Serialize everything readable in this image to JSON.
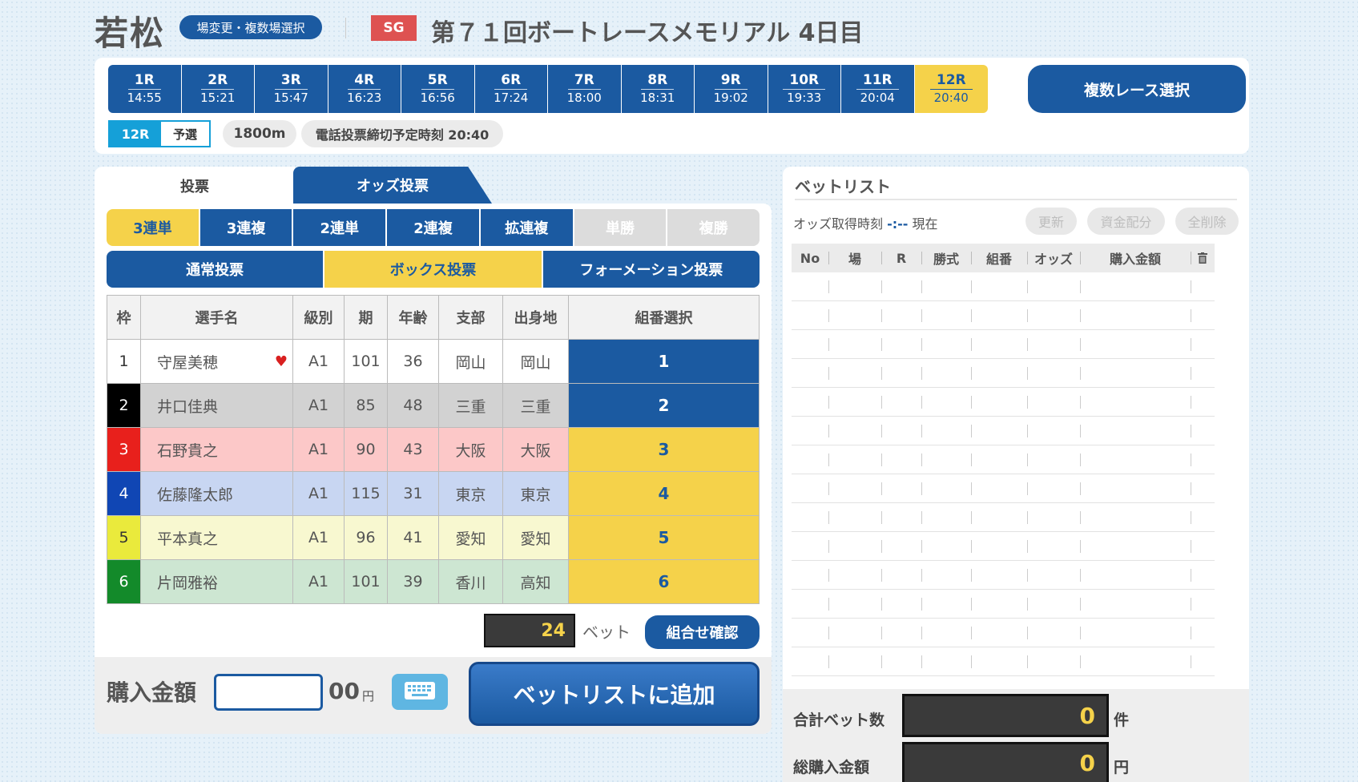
{
  "header": {
    "venue": "若松",
    "venue_change_label": "場変更・複数場選択",
    "grade": "SG",
    "race_title": "第７１回ボートレースメモリアル 4日目"
  },
  "races": [
    {
      "no": "1R",
      "time": "14:55"
    },
    {
      "no": "2R",
      "time": "15:21"
    },
    {
      "no": "3R",
      "time": "15:47"
    },
    {
      "no": "4R",
      "time": "16:23"
    },
    {
      "no": "5R",
      "time": "16:56"
    },
    {
      "no": "6R",
      "time": "17:24"
    },
    {
      "no": "7R",
      "time": "18:00"
    },
    {
      "no": "8R",
      "time": "18:31"
    },
    {
      "no": "9R",
      "time": "19:02"
    },
    {
      "no": "10R",
      "time": "19:33"
    },
    {
      "no": "11R",
      "time": "20:04"
    },
    {
      "no": "12R",
      "time": "20:40"
    }
  ],
  "active_race_index": 11,
  "multi_race_label": "複数レース選択",
  "race_info": {
    "race": "12R",
    "kind": "予選",
    "distance": "1800m",
    "deadline": "電話投票締切予定時刻 20:40"
  },
  "tabs": {
    "vote": "投票",
    "odds_vote": "オッズ投票"
  },
  "bet_types": [
    {
      "label": "3連単",
      "state": "active"
    },
    {
      "label": "3連複",
      "state": "normal"
    },
    {
      "label": "2連単",
      "state": "normal"
    },
    {
      "label": "2連複",
      "state": "normal"
    },
    {
      "label": "拡連複",
      "state": "normal"
    },
    {
      "label": "単勝",
      "state": "disabled"
    },
    {
      "label": "複勝",
      "state": "disabled"
    }
  ],
  "modes": [
    {
      "label": "通常投票",
      "state": "normal"
    },
    {
      "label": "ボックス投票",
      "state": "active"
    },
    {
      "label": "フォーメーション投票",
      "state": "normal"
    }
  ],
  "racer_table": {
    "headers": [
      "枠",
      "選手名",
      "級別",
      "期",
      "年齢",
      "支部",
      "出身地",
      "組番選択"
    ],
    "rows": [
      {
        "waku": "1",
        "name": "守屋美穂",
        "favorite": true,
        "class": "A1",
        "term": "101",
        "age": "36",
        "branch": "岡山",
        "birthplace": "岡山",
        "select": "1",
        "selected": true
      },
      {
        "waku": "2",
        "name": "井口佳典",
        "favorite": false,
        "class": "A1",
        "term": "85",
        "age": "48",
        "branch": "三重",
        "birthplace": "三重",
        "select": "2",
        "selected": true
      },
      {
        "waku": "3",
        "name": "石野貴之",
        "favorite": false,
        "class": "A1",
        "term": "90",
        "age": "43",
        "branch": "大阪",
        "birthplace": "大阪",
        "select": "3",
        "selected": false
      },
      {
        "waku": "4",
        "name": "佐藤隆太郎",
        "favorite": false,
        "class": "A1",
        "term": "115",
        "age": "31",
        "branch": "東京",
        "birthplace": "東京",
        "select": "4",
        "selected": false
      },
      {
        "waku": "5",
        "name": "平本真之",
        "favorite": false,
        "class": "A1",
        "term": "96",
        "age": "41",
        "branch": "愛知",
        "birthplace": "愛知",
        "select": "5",
        "selected": false
      },
      {
        "waku": "6",
        "name": "片岡雅裕",
        "favorite": false,
        "class": "A1",
        "term": "101",
        "age": "39",
        "branch": "香川",
        "birthplace": "高知",
        "select": "6",
        "selected": false
      }
    ]
  },
  "waku_colors": [
    {
      "bg": "#ffffff",
      "fg": "#333333",
      "row": "#ffffff"
    },
    {
      "bg": "#000000",
      "fg": "#ffffff",
      "row": "#d2d2d2"
    },
    {
      "bg": "#e8201c",
      "fg": "#ffffff",
      "row": "#fcc8c8"
    },
    {
      "bg": "#1046b4",
      "fg": "#ffffff",
      "row": "#c8d6f2"
    },
    {
      "bg": "#eaea3c",
      "fg": "#333333",
      "row": "#f8f8d0"
    },
    {
      "bg": "#138a2a",
      "fg": "#ffffff",
      "row": "#cde6d2"
    }
  ],
  "colors": {
    "accent": "#1b5aa1",
    "highlight": "#f5d24a",
    "selected_cell": "#1b5aa1",
    "unselected_cell": "#f5d24a"
  },
  "bet_summary": {
    "count": "24",
    "unit": "ベット",
    "confirm_label": "組合せ確認"
  },
  "purchase": {
    "label": "購入金額",
    "value": "",
    "hundreds": "00",
    "yen": "円",
    "keyboard_icon": "keyboard-icon",
    "add_label": "ベットリストに追加"
  },
  "bet_list": {
    "title": "ベットリスト",
    "odds_time_label": "オッズ取得時刻",
    "odds_time_value": "-:--",
    "odds_time_suffix": "現在",
    "buttons": {
      "update": "更新",
      "allocate": "資金配分",
      "clear_all": "全削除"
    },
    "headers": [
      "No",
      "場",
      "R",
      "勝式",
      "組番",
      "オッズ",
      "購入金額"
    ],
    "trash_icon": "trash-icon",
    "rows": [
      [],
      [],
      [],
      [],
      [],
      [],
      [],
      [],
      [],
      [],
      [],
      [],
      [],
      []
    ]
  },
  "totals": {
    "bet_count_label": "合計ベット数",
    "bet_count": "0",
    "bet_count_unit": "件",
    "amount_label": "総購入金額",
    "amount": "0",
    "amount_unit": "円"
  }
}
